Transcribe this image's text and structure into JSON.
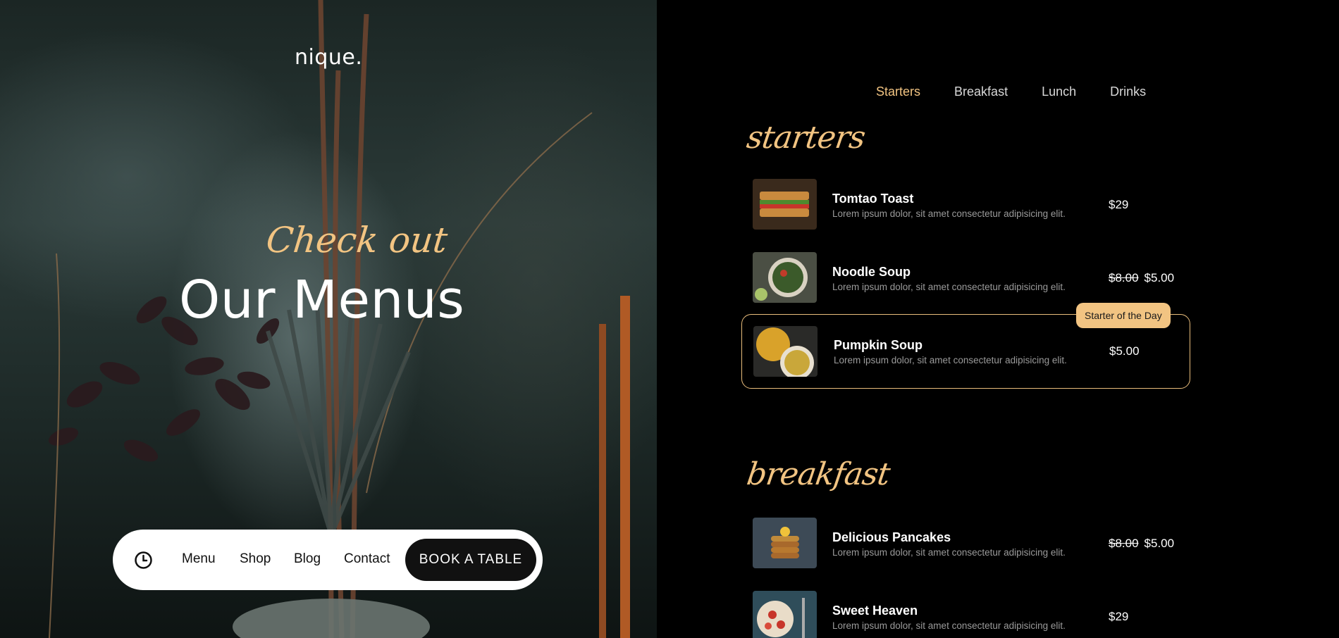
{
  "hero": {
    "logo": "nique.",
    "kicker": "Check out",
    "headline": "Our Menus"
  },
  "nav": {
    "clock_icon": "clock-icon",
    "links": [
      "Menu",
      "Shop",
      "Blog",
      "Contact"
    ],
    "cta": "BOOK A TABLE"
  },
  "menu": {
    "tabs": [
      {
        "label": "Starters",
        "active": true
      },
      {
        "label": "Breakfast",
        "active": false
      },
      {
        "label": "Lunch",
        "active": false
      },
      {
        "label": "Drinks",
        "active": false
      }
    ],
    "sections": [
      {
        "title": "starters",
        "items": [
          {
            "name": "Tomtao Toast",
            "desc": "Lorem ipsum dolor, sit amet consectetur adipisicing elit.",
            "old_price": "",
            "price": "$29",
            "badge": ""
          },
          {
            "name": "Noodle Soup",
            "desc": "Lorem ipsum dolor, sit amet consectetur adipisicing elit.",
            "old_price": "$8.00",
            "price": "$5.00",
            "badge": ""
          },
          {
            "name": "Pumpkin Soup",
            "desc": "Lorem ipsum dolor, sit amet consectetur adipisicing elit.",
            "old_price": "",
            "price": "$5.00",
            "badge": "Starter of the Day"
          }
        ]
      },
      {
        "title": "breakfast",
        "items": [
          {
            "name": "Delicious Pancakes",
            "desc": "Lorem ipsum dolor, sit amet consectetur adipisicing elit.",
            "old_price": "$8.00",
            "price": "$5.00",
            "badge": ""
          },
          {
            "name": "Sweet Heaven",
            "desc": "Lorem ipsum dolor, sit amet consectetur adipisicing elit.",
            "old_price": "",
            "price": "$29",
            "badge": ""
          }
        ]
      }
    ]
  },
  "colors": {
    "accent": "#f2c482",
    "background": "#000000",
    "pill": "#ffffff"
  }
}
